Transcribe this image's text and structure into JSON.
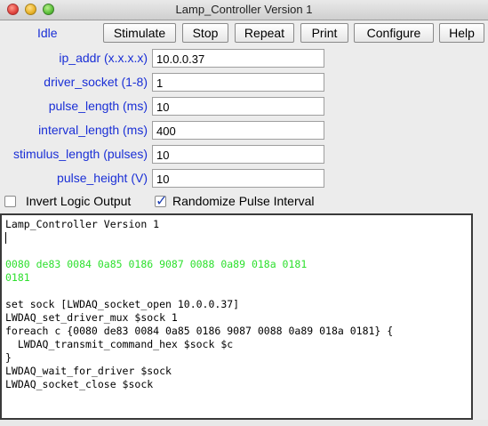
{
  "window": {
    "title": "Lamp_Controller Version 1"
  },
  "toolbar": {
    "state": "Idle",
    "buttons": [
      "Stimulate",
      "Stop",
      "Repeat",
      "Print",
      "Configure",
      "Help"
    ]
  },
  "params": [
    {
      "label": "ip_addr (x.x.x.x)",
      "value": "10.0.0.37"
    },
    {
      "label": "driver_socket (1-8)",
      "value": "1"
    },
    {
      "label": "pulse_length (ms)",
      "value": "10"
    },
    {
      "label": "interval_length (ms)",
      "value": "400"
    },
    {
      "label": "stimulus_length (pulses)",
      "value": "10"
    },
    {
      "label": "pulse_height (V)",
      "value": "10"
    }
  ],
  "options": {
    "invert_logic": {
      "label": "Invert Logic Output",
      "checked": false
    },
    "randomize": {
      "label": "Randomize Pulse Interval",
      "checked": true
    }
  },
  "console": {
    "header": "Lamp_Controller Version 1",
    "hex_line_1": "0080 de83 0084 0a85 0186 9087 0088 0a89 018a 0181",
    "hex_line_2": "0181",
    "script": [
      "set sock [LWDAQ_socket_open 10.0.0.37]",
      "LWDAQ_set_driver_mux $sock 1",
      "foreach c {0080 de83 0084 0a85 0186 9087 0088 0a89 018a 0181} {",
      "  LWDAQ_transmit_command_hex $sock $c",
      "}",
      "LWDAQ_wait_for_driver $sock",
      "LWDAQ_socket_close $sock"
    ]
  },
  "colors": {
    "label_blue": "#1a2fd6",
    "console_green": "#2ee02e"
  }
}
